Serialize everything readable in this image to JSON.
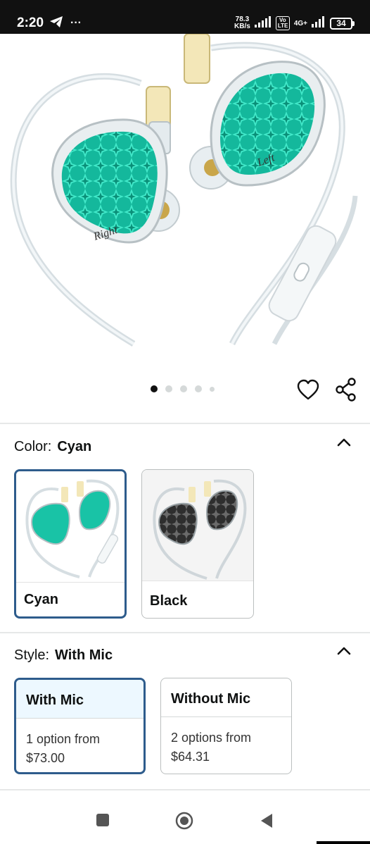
{
  "status_bar": {
    "time": "2:20",
    "extra": "···",
    "net_speed_value": "78.3",
    "net_speed_unit": "KB/s",
    "volte": "Vo LTE",
    "network": "4G+",
    "battery": "34"
  },
  "gallery": {
    "image_count": 5,
    "active_index": 0,
    "left_label": "Left",
    "right_label": "Right"
  },
  "color_section": {
    "label": "Color:",
    "selected": "Cyan",
    "options": [
      {
        "label": "Cyan",
        "accent": "#19c3a6"
      },
      {
        "label": "Black",
        "accent": "#3a3a3a"
      }
    ]
  },
  "style_section": {
    "label": "Style:",
    "selected": "With Mic",
    "options": [
      {
        "label": "With Mic",
        "option_line": "1 option from",
        "price": "$73.00"
      },
      {
        "label": "Without Mic",
        "option_line": "2 options from",
        "price": "$64.31"
      }
    ]
  },
  "colors": {
    "selected_border": "#2e5c8c",
    "selected_fill": "#edf8ff",
    "teal": "#19c3a6"
  }
}
